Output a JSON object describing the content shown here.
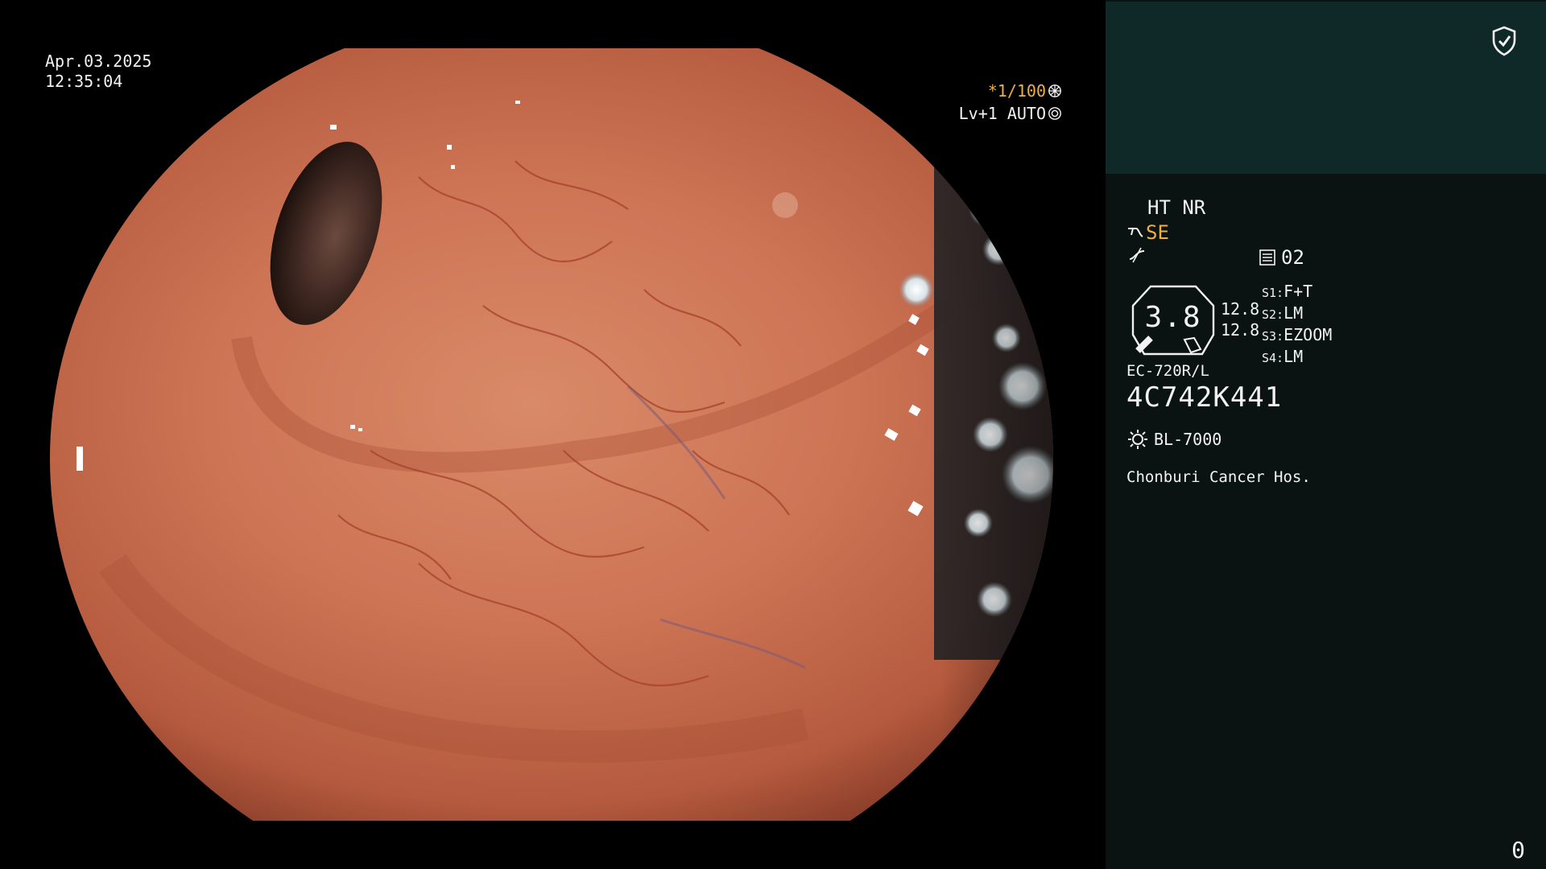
{
  "overlay": {
    "date": "Apr.03.2025",
    "time": "12:35:04",
    "shutter": "*1/100",
    "gain": "Lv+1 AUTO"
  },
  "panel": {
    "mode": "HT NR",
    "enhance": "SE",
    "file_no": "02",
    "gauge_value": "3.8",
    "gauge_sub_1": "12.8",
    "gauge_sub_2": "12.8",
    "settings": [
      {
        "label": "S1:",
        "value": "F+T"
      },
      {
        "label": "S2:",
        "value": "LM"
      },
      {
        "label": "S3:",
        "value": "EZOOM"
      },
      {
        "label": "S4:",
        "value": "LM"
      }
    ],
    "scope_model": "EC-720R/L",
    "serial": "4C742K441",
    "light_source": "BL-7000",
    "hospital": "Chonburi Cancer Hos.",
    "counter": "0"
  },
  "colors": {
    "panel_bg": "#0a1212",
    "panel_top": "#0f2828",
    "accent": "#f0b040",
    "text": "#f2f2f2"
  }
}
